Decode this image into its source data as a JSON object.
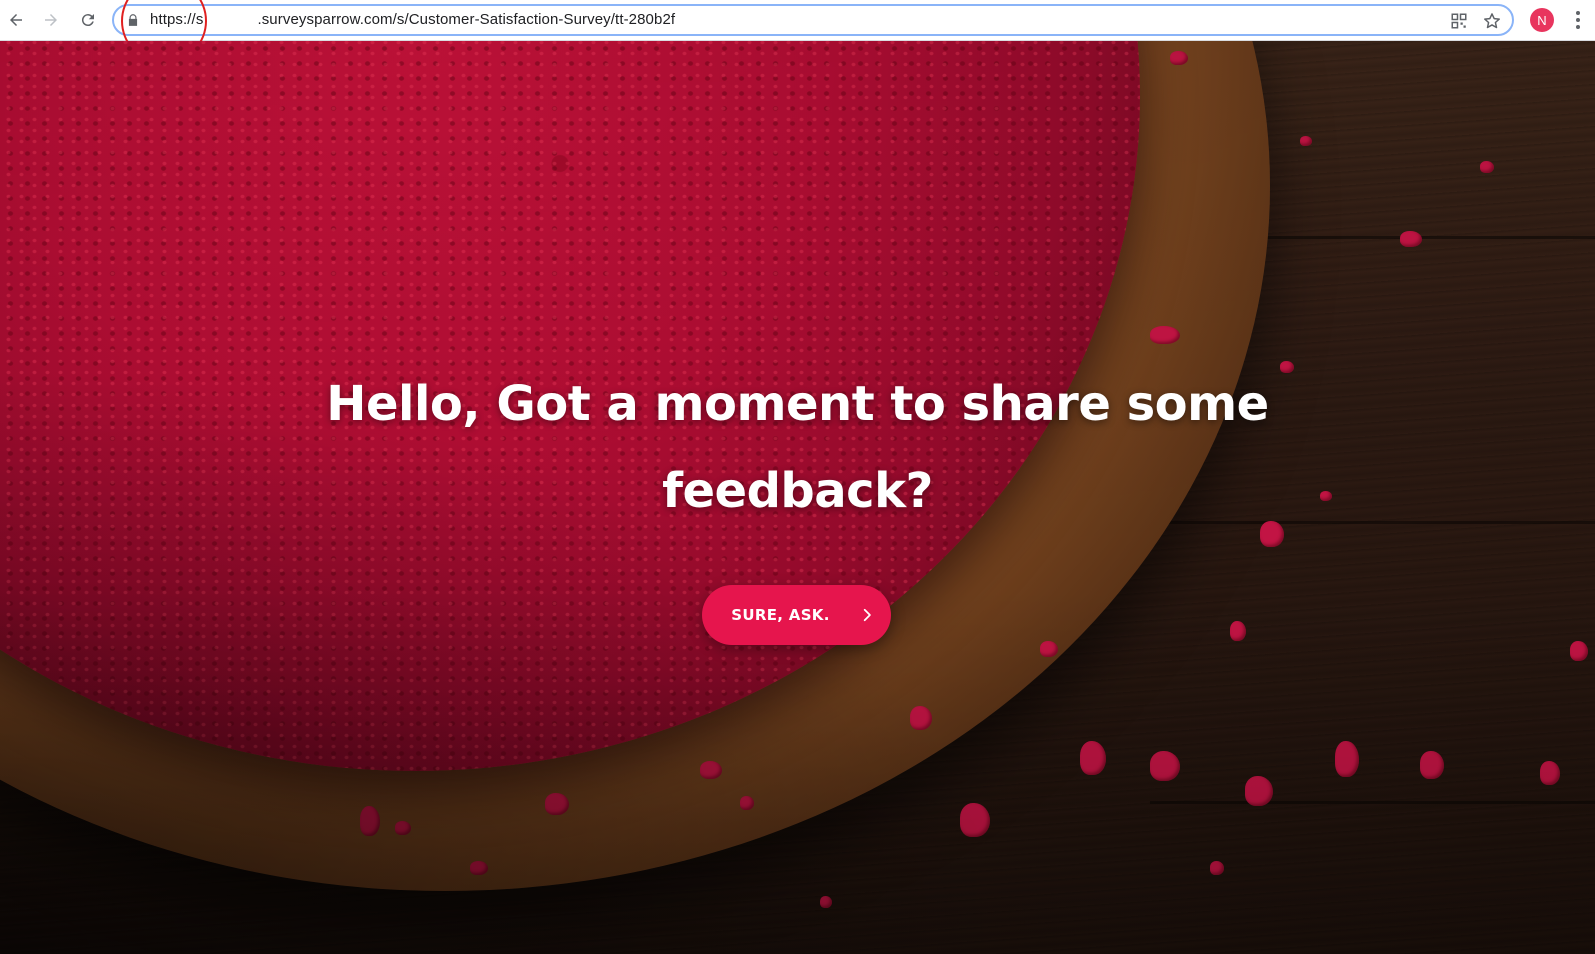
{
  "browser": {
    "url_scheme": "https://s",
    "url_rest": ".surveysparrow.com/s/Customer-Satisfaction-Survey/tt-280b2f",
    "profile_initial": "N",
    "icons": {
      "back": "arrow-left-icon",
      "forward": "arrow-right-icon",
      "reload": "reload-icon",
      "lock": "lock-icon",
      "qr": "qr-code-icon",
      "bookmark": "star-icon",
      "menu": "kebab-menu-icon"
    }
  },
  "survey": {
    "headline_line1": "Hello, Got a moment to share some",
    "headline_line2": "feedback?",
    "cta_label": "SURE, ASK.",
    "cta_icon": "chevron-right-icon"
  },
  "colors": {
    "accent": "#e6154d",
    "annotation": "#e02020",
    "omnibox_focus": "#8ab4f8"
  }
}
